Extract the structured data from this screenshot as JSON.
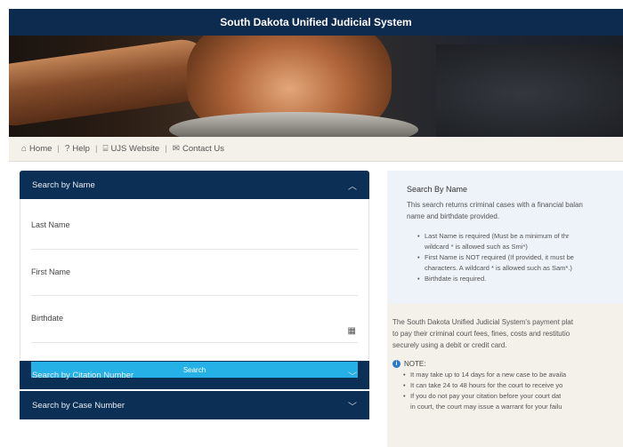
{
  "header": {
    "title": "South Dakota Unified Judicial System"
  },
  "nav": {
    "items": [
      {
        "label": "Home",
        "icon": "home-icon",
        "glyph": "⌂"
      },
      {
        "label": "Help",
        "icon": "help-icon",
        "glyph": "?"
      },
      {
        "label": "UJS Website",
        "icon": "courthouse-icon",
        "glyph": "⌸"
      },
      {
        "label": "Contact Us",
        "icon": "contact-icon",
        "glyph": "✉"
      }
    ]
  },
  "search_by_name": {
    "header": "Search by Name",
    "last_name_label": "Last Name",
    "last_name_value": "",
    "first_name_label": "First Name",
    "first_name_value": "",
    "birthdate_label": "Birthdate",
    "birthdate_value": "",
    "search_button": "Search"
  },
  "accordions": {
    "citation": "Search by Citation Number",
    "case": "Search by Case Number"
  },
  "info": {
    "title": "Search By Name",
    "line1": "This search returns criminal cases with a financial balan",
    "line2": "name and birthdate provided.",
    "bullets": [
      "Last Name is required (Must be a minimum of thr",
      "wildcard * is allowed such as Smi*)",
      "First Name is NOT required (If provided, it must be",
      "characters. A wildcard * is allowed such as Sam*.)",
      "Birthdate is required."
    ],
    "payment_line1": "The South Dakota Unified Judicial System's payment plat",
    "payment_line2": "to pay their criminal court fees, fines, costs and restitutio",
    "payment_line3": "securely using a debit or credit card.",
    "note_label": "NOTE:",
    "notes": [
      "It may take up to 14 days for a new case to be availa",
      "It can take 24 to 48 hours for the court to receive yo",
      "If you do not pay your citation before your court dat",
      "in court, the court may issue a warrant for your failu"
    ]
  },
  "colors": {
    "header_bg": "#0d2a4f",
    "accordion_bg": "#0b2f55",
    "button_bg": "#26b1e6",
    "info_bg": "#edf3f9",
    "nav_bg": "#f4f1ea"
  }
}
